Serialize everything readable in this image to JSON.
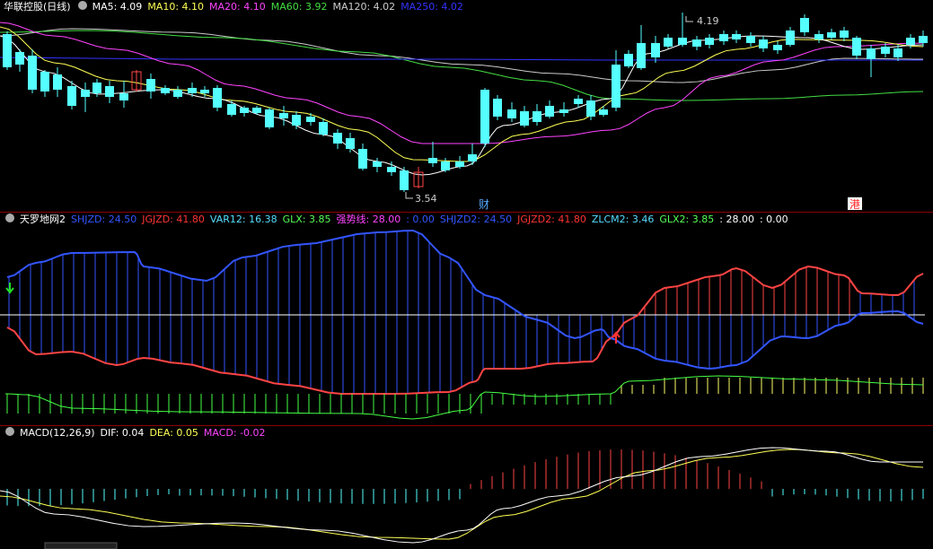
{
  "main": {
    "title": "华联控股",
    "period": "(日线)",
    "ma": [
      {
        "label": "MA5:",
        "value": "4.09",
        "color": "#ffffff"
      },
      {
        "label": "MA10:",
        "value": "4.10",
        "color": "#ffff55"
      },
      {
        "label": "MA20:",
        "value": "4.10",
        "color": "#ff44ff"
      },
      {
        "label": "MA60:",
        "value": "3.92",
        "color": "#44dd44"
      },
      {
        "label": "MA120:",
        "value": "4.02",
        "color": "#cccccc"
      },
      {
        "label": "MA250:",
        "value": "4.02",
        "color": "#3333ff"
      }
    ],
    "high_label": "4.19",
    "low_label": "3.54",
    "event_cai": "财",
    "event_gang": "港"
  },
  "tianluo": {
    "title": "天罗地网2",
    "items": [
      {
        "label": "SHJZD:",
        "value": "24.50",
        "color": "#3355ff"
      },
      {
        "label": "JGJZD:",
        "value": "41.80",
        "color": "#ff3333"
      },
      {
        "label": "VAR12:",
        "value": "16.38",
        "color": "#55ddff"
      },
      {
        "label": "GLX:",
        "value": "3.85",
        "color": "#55ff55"
      },
      {
        "label": "强势线:",
        "value": "28.00",
        "color": "#ff44ff"
      },
      {
        "label": ":",
        "value": "0.00",
        "color": "#3355ff"
      },
      {
        "label": "SHJZD2:",
        "value": "24.50",
        "color": "#3355ff"
      },
      {
        "label": "JGJZD2:",
        "value": "41.80",
        "color": "#ff3333"
      },
      {
        "label": "ZLCM2:",
        "value": "3.46",
        "color": "#55ddff"
      },
      {
        "label": "GLX2:",
        "value": "3.85",
        "color": "#55ff55"
      },
      {
        "label": ":",
        "value": "28.00",
        "color": "#ffffff"
      },
      {
        "label": ":",
        "value": "0.00",
        "color": "#ffffff"
      }
    ]
  },
  "macd": {
    "title": "MACD(12,26,9)",
    "items": [
      {
        "label": "DIF:",
        "value": "0.04",
        "color": "#ffffff"
      },
      {
        "label": "DEA:",
        "value": "0.05",
        "color": "#ffff55"
      },
      {
        "label": "MACD:",
        "value": "-0.02",
        "color": "#ff44ff"
      }
    ]
  },
  "colors": {
    "up": "#ff4444",
    "down": "#55ffff",
    "ma5": "#ffffff",
    "ma10": "#ffff55",
    "ma20": "#ff44ff",
    "ma60": "#44dd44",
    "ma120": "#cccccc",
    "ma250": "#3333ff"
  }
}
